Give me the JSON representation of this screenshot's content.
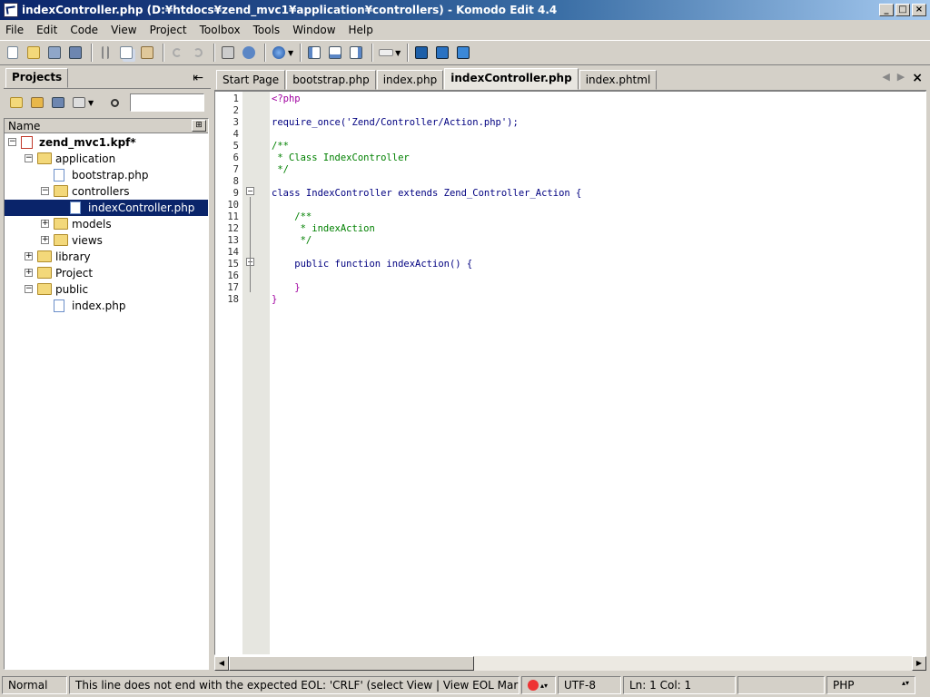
{
  "window": {
    "title": "indexController.php (D:¥htdocs¥zend_mvc1¥application¥controllers) - Komodo Edit 4.4",
    "controls": [
      "_",
      "□",
      "×"
    ]
  },
  "menu": [
    "File",
    "Edit",
    "Code",
    "View",
    "Project",
    "Toolbox",
    "Tools",
    "Window",
    "Help"
  ],
  "toolbar": {
    "icons": [
      "new-file-icon",
      "open-folder-icon",
      "save-icon",
      "save-all-icon",
      "cut-icon",
      "copy-icon",
      "paste-icon",
      "undo-icon",
      "redo-icon",
      "print-icon",
      "help-icon",
      "browser-preview-icon",
      "pane-left-icon",
      "pane-bottom-icon",
      "pane-right-icon",
      "keyboard-icon",
      "komodo-tool-icon",
      "komodo-refresh-icon",
      "komodo-debug-icon"
    ]
  },
  "projects": {
    "tab_label": "Projects",
    "pin_glyph": "⇤",
    "search_placeholder": "",
    "column_header": "Name",
    "tree": [
      {
        "label": "zend_mvc1.kpf*",
        "type": "project",
        "expanded": true,
        "bold": true
      },
      {
        "label": "application",
        "type": "folder",
        "expanded": true
      },
      {
        "label": "bootstrap.php",
        "type": "file"
      },
      {
        "label": "controllers",
        "type": "folder",
        "expanded": true
      },
      {
        "label": "indexController.php",
        "type": "file",
        "selected": true
      },
      {
        "label": "models",
        "type": "folder",
        "expanded": false
      },
      {
        "label": "views",
        "type": "folder",
        "expanded": false
      },
      {
        "label": "library",
        "type": "folder",
        "expanded": false
      },
      {
        "label": "Project",
        "type": "folder",
        "expanded": false
      },
      {
        "label": "public",
        "type": "folder",
        "expanded": true
      },
      {
        "label": "index.php",
        "type": "file"
      }
    ]
  },
  "editor": {
    "tabs": [
      "Start Page",
      "bootstrap.php",
      "index.php",
      "indexController.php",
      "index.phtml"
    ],
    "active_tab": "indexController.php",
    "nav": {
      "prev": "◀",
      "next": "▶",
      "close": "×"
    },
    "lines": [
      "<?php",
      "",
      "require_once('Zend/Controller/Action.php');",
      "",
      "/**",
      " * Class IndexController",
      " */",
      "",
      "class IndexController extends Zend_Controller_Action {",
      "",
      "    /**",
      "     * indexAction",
      "     */",
      "",
      "    public function indexAction() {",
      "",
      "    }",
      "}"
    ],
    "line_numbers": [
      "1",
      "2",
      "3",
      "4",
      "5",
      "6",
      "7",
      "8",
      "9",
      "10",
      "11",
      "12",
      "13",
      "14",
      "15",
      "16",
      "17",
      "18"
    ]
  },
  "statusbar": {
    "mode": "Normal",
    "message": "This line does not end with the expected EOL: 'CRLF' (select View | View EOL Markers)",
    "encoding": "UTF-8",
    "position": "Ln: 1 Col: 1",
    "language": "PHP"
  }
}
